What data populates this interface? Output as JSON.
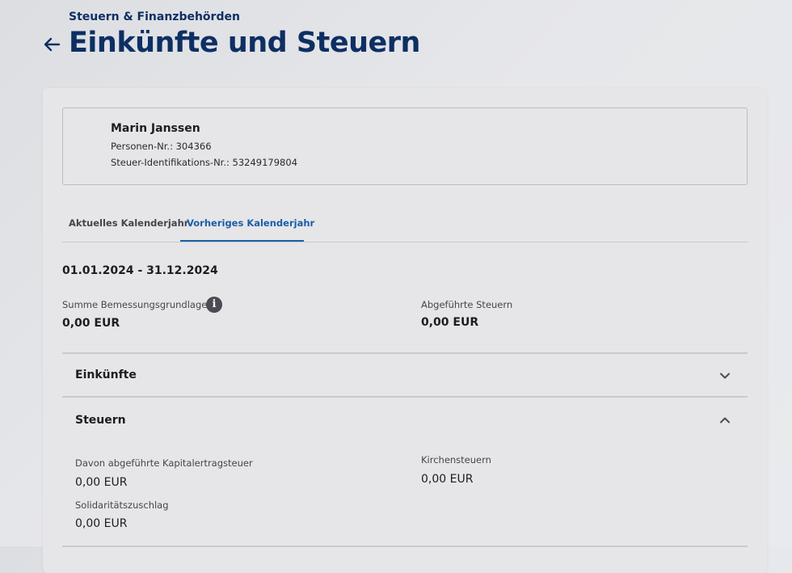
{
  "header": {
    "breadcrumb": "Steuern & Finanzbehörden",
    "title": "Einkünfte und Steuern"
  },
  "person": {
    "name": "Marin Janssen",
    "personal_number": "Personen-Nr.: 304366",
    "tax_id": "Steuer-Identifikations-Nr.: 53249179804"
  },
  "tabs": [
    {
      "label": "Aktuelles Kalenderjahr",
      "active": false
    },
    {
      "label": "Vorheriges Kalenderjahr",
      "active": true
    }
  ],
  "period": "01.01.2024 - 31.12.2024",
  "summary": {
    "base_label": "Summe Bemessungsgrundlage",
    "base_value": "0,00 EUR",
    "paid_label": "Abgeführte Steuern",
    "paid_value": "0,00 EUR"
  },
  "sections": {
    "income": {
      "title": "Einkünfte",
      "expanded": false
    },
    "taxes": {
      "title": "Steuern",
      "expanded": true,
      "capital_label": "Davon abgeführte Kapitalertragsteuer",
      "capital_value": "0,00 EUR",
      "church_label": "Kirchensteuern",
      "church_value": "0,00 EUR",
      "soli_label": "Solidaritätszuschlag",
      "soli_value": "0,00 EUR"
    }
  },
  "colors": {
    "primary": "#0e2f63",
    "accent": "#1a5ea8"
  },
  "icons": {
    "back": "arrow-left-icon",
    "info": "info-icon",
    "expand": "chevron-down-icon",
    "collapse": "chevron-up-icon"
  }
}
